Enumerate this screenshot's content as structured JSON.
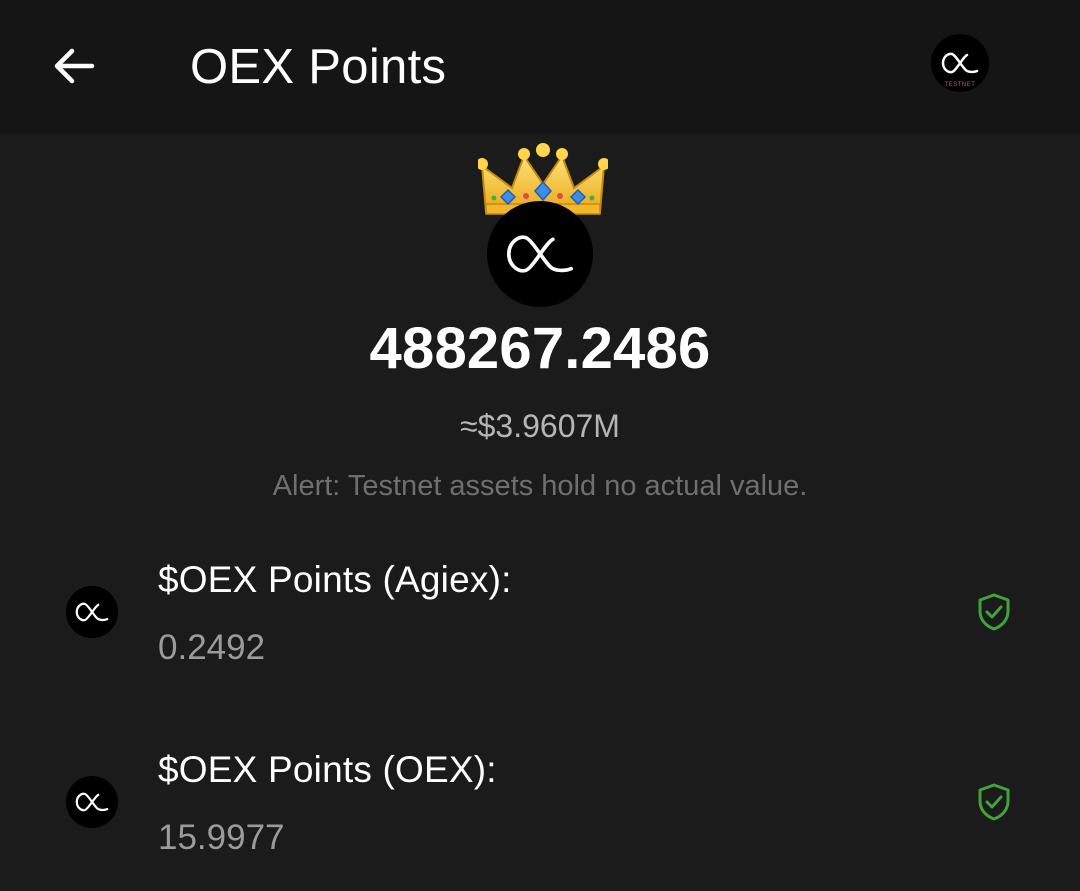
{
  "header": {
    "title": "OEX Points",
    "back_icon": "arrow-left-icon",
    "avatar_tag": "TESTNET"
  },
  "hero": {
    "crown_icon": "crown-emoji",
    "balance": "488267.2486",
    "usd_value": "≈$3.9607M",
    "alert": "Alert: Testnet assets hold no actual value."
  },
  "assets": [
    {
      "label": "$OEX Points (Agiex):",
      "value": "0.2492",
      "verified_icon": "shield-check-icon"
    },
    {
      "label": "$OEX Points (OEX):",
      "value": "15.9977",
      "verified_icon": "shield-check-icon"
    }
  ],
  "colors": {
    "background": "#1b1b1b",
    "header_background": "#151515",
    "primary_text": "#ffffff",
    "secondary_text": "#9b9b9b",
    "alert_text": "#6f6f6f",
    "verified_green": "#3fa33a"
  }
}
